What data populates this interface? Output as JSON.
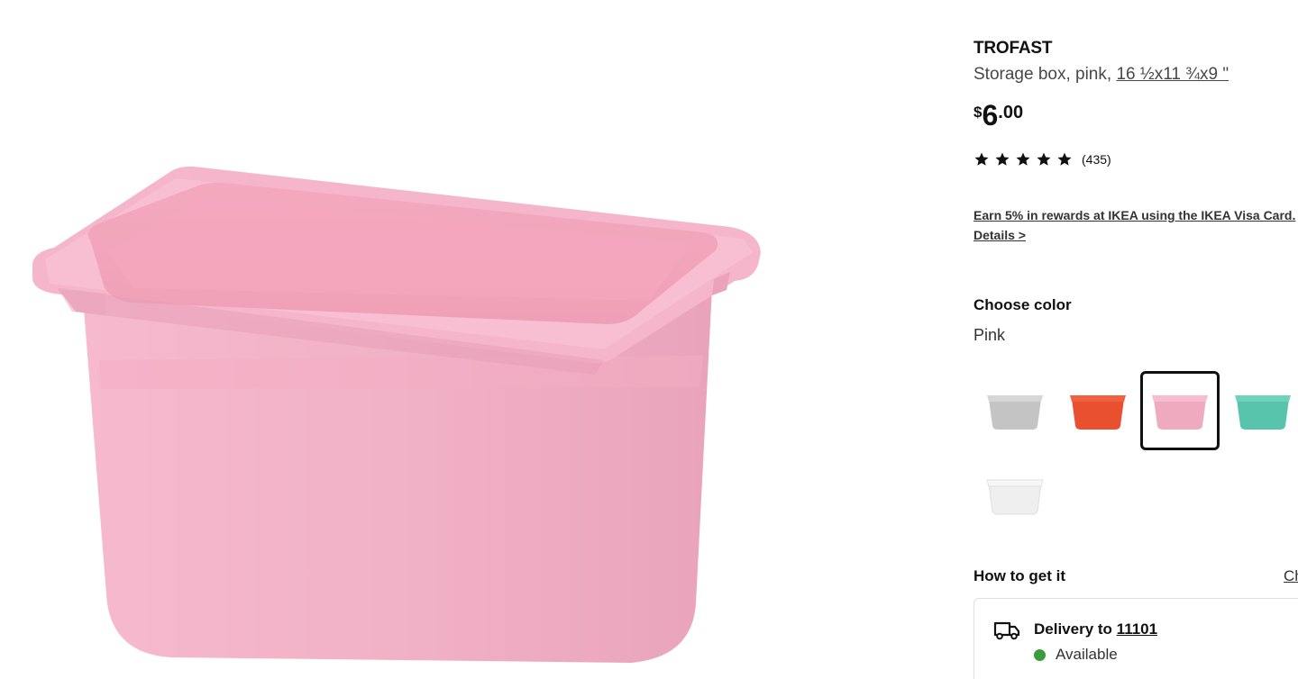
{
  "product": {
    "name": "TROFAST",
    "description_prefix": "Storage box, pink,",
    "dimensions": "16 ½x11 ¾x9 \"",
    "price": {
      "currency": "$",
      "integer": "6",
      "decimal": ".00"
    },
    "rating": {
      "stars": 5,
      "count_label": "(435)"
    }
  },
  "rewards": {
    "line1": "Earn 5% in rewards at IKEA using the IKEA Visa Card.",
    "details_link": "Details >"
  },
  "color": {
    "title": "Choose color",
    "selected_label": "Pink",
    "swatches": [
      {
        "name": "gray",
        "color": "#c9c9c9"
      },
      {
        "name": "red",
        "color": "#ee5636"
      },
      {
        "name": "pink",
        "color": "#f2a9c1",
        "selected": true
      },
      {
        "name": "turquoise",
        "color": "#5fc9b1"
      },
      {
        "name": "white",
        "color": "#f2f2f2"
      }
    ]
  },
  "fulfillment": {
    "title": "How to get it",
    "change_link": "Change store",
    "delivery_prefix": "Delivery to",
    "zip": "11101",
    "availability": "Available",
    "availability_color": "#3a9b3f"
  },
  "icons": {
    "star": "star-icon",
    "truck": "truck-icon",
    "status": "available-dot-icon"
  },
  "colors": {
    "product_pink": "#f4b3c8",
    "text_primary": "#111111"
  }
}
